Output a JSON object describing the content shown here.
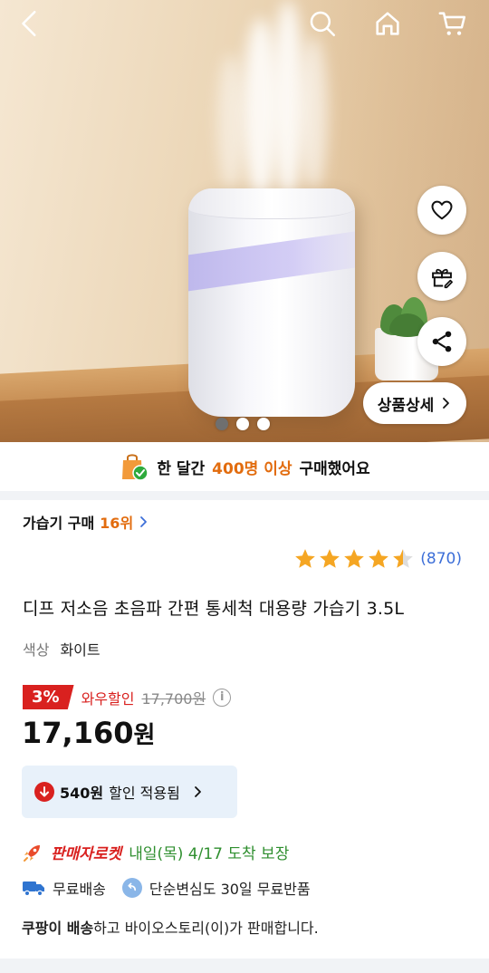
{
  "header": {
    "back_icon": "chevron-left-icon",
    "search_icon": "search-icon",
    "home_icon": "home-icon",
    "cart_icon": "cart-icon"
  },
  "gallery": {
    "detail_button_label": "상품상세",
    "slide_count": 3,
    "active_slide": 1
  },
  "purchase_banner": {
    "prefix": "한 달간",
    "highlight": "400명 이상",
    "suffix": "구매했어요"
  },
  "ranking": {
    "category_label": "가습기 구매",
    "rank": "16위"
  },
  "rating": {
    "stars": 4.5,
    "review_count": "(870)"
  },
  "product": {
    "title": "디프 저소음 초음파 간편 통세척 대용량 가습기 3.5L",
    "option_label": "색상",
    "option_value": "화이트"
  },
  "price": {
    "discount_badge": "3%",
    "wow_label": "와우할인",
    "original_price": "17,700원",
    "sale_price_number": "17,160",
    "sale_price_unit": "원"
  },
  "coupon": {
    "amount": "540원",
    "label": "할인 적용됨"
  },
  "delivery": {
    "rocket_label": "판매자로켓",
    "arrival_text": "내일(목) 4/17 도착 보장",
    "free_shipping": "무료배송",
    "free_return": "단순변심도 30일 무료반품"
  },
  "seller": {
    "prefix_bold": "쿠팡이 배송",
    "rest": "하고 바이오스토리(이)가 판매합니다."
  },
  "colors": {
    "accent_orange": "#e26c0e",
    "discount_red": "#d9211f",
    "review_blue": "#3d6fd8",
    "arrival_green": "#2f8f2f",
    "star_gold": "#f5a623"
  }
}
